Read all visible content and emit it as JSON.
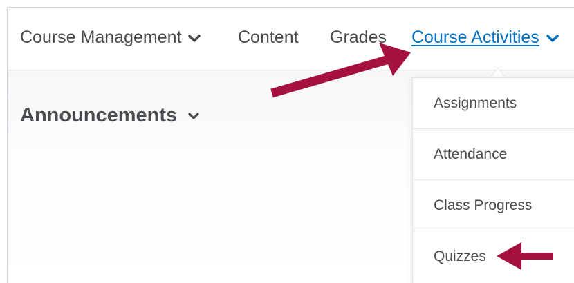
{
  "navbar": {
    "items": [
      {
        "label": "Course Management",
        "has_chevron": true
      },
      {
        "label": "Content",
        "has_chevron": false
      },
      {
        "label": "Grades",
        "has_chevron": false
      },
      {
        "label": "Course Activities",
        "has_chevron": true,
        "active": true
      }
    ]
  },
  "widget": {
    "title": "Announcements"
  },
  "dropdown": {
    "items": [
      {
        "label": "Assignments"
      },
      {
        "label": "Attendance"
      },
      {
        "label": "Class Progress"
      },
      {
        "label": "Quizzes"
      }
    ]
  },
  "colors": {
    "text": "#494c4e",
    "link_active": "#006fbf",
    "annotation_arrow": "#a5123f"
  },
  "icons": [
    "chevron-down-icon",
    "annotation-arrow-icon"
  ]
}
